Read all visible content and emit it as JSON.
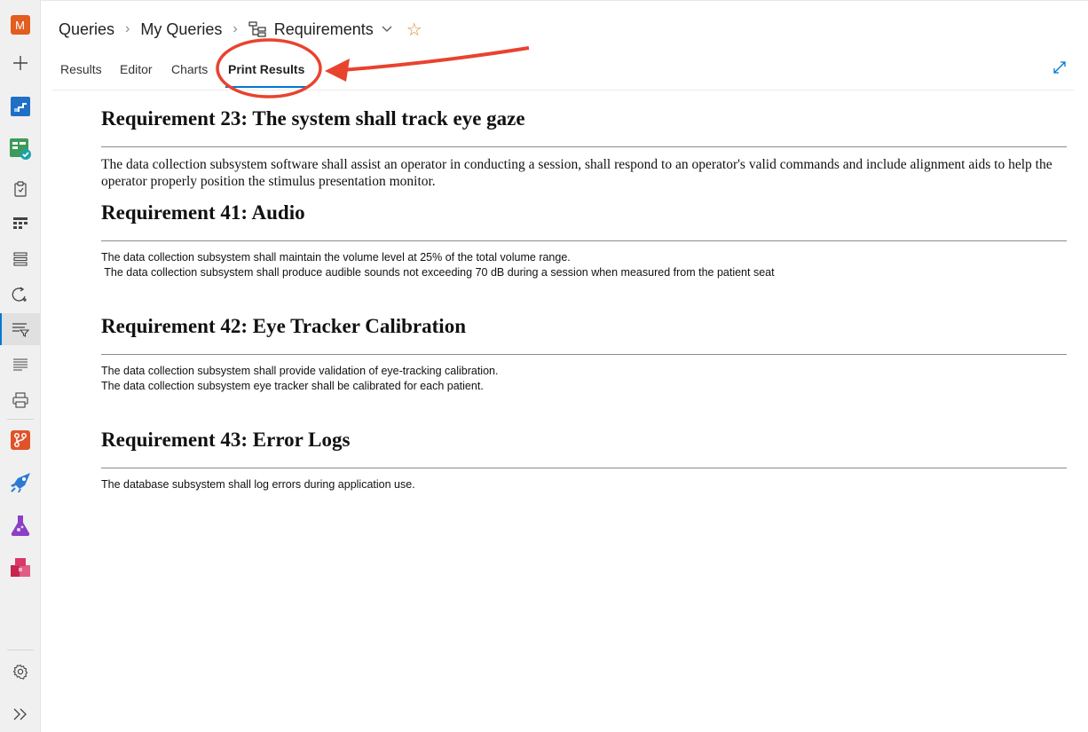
{
  "rail": {
    "avatar_letter": "M",
    "avatar_color": "#e35d1e",
    "items": [
      {
        "name": "new-item-icon"
      },
      {
        "name": "overview-icon"
      },
      {
        "name": "boards-icon"
      },
      {
        "name": "work-items-icon"
      },
      {
        "name": "boards-grid-icon"
      },
      {
        "name": "backlogs-icon"
      },
      {
        "name": "sprints-icon"
      },
      {
        "name": "queries-icon",
        "selected": true
      },
      {
        "name": "delivery-plans-icon"
      },
      {
        "name": "print-icon"
      },
      {
        "name": "repos-icon"
      },
      {
        "name": "pipelines-icon"
      },
      {
        "name": "test-plans-icon"
      },
      {
        "name": "artifacts-icon"
      },
      {
        "name": "settings-icon"
      },
      {
        "name": "collapse-icon"
      }
    ]
  },
  "breadcrumb": {
    "root": "Queries",
    "folder": "My Queries",
    "current": "Requirements"
  },
  "tabs": [
    {
      "label": "Results"
    },
    {
      "label": "Editor"
    },
    {
      "label": "Charts"
    },
    {
      "label": "Print Results",
      "active": true
    }
  ],
  "colors": {
    "accent": "#0078d4",
    "annotation": "#e8432f",
    "star": "#d8892e"
  },
  "requirements": [
    {
      "title": "Requirement 23: The system shall track eye gaze",
      "style": "serif",
      "lines": [
        "The data collection subsystem software shall assist an operator in conducting a session, shall respond to an operator's valid commands and include alignment aids to help the operator properly position the stimulus presentation monitor."
      ]
    },
    {
      "title": "Requirement 41: Audio",
      "style": "sans",
      "lines": [
        "The data collection subsystem shall maintain the volume level at 25% of the total volume range.",
        " The data collection subsystem shall produce audible sounds not exceeding 70 dB during a session when measured from the patient seat"
      ]
    },
    {
      "title": "Requirement 42: Eye Tracker Calibration",
      "style": "sans",
      "lines": [
        "The data collection subsystem shall provide validation of eye-tracking calibration.",
        "The data collection subsystem eye tracker shall be calibrated for each patient."
      ]
    },
    {
      "title": "Requirement 43: Error Logs",
      "style": "sans",
      "lines": [
        "The database subsystem shall log errors during application use."
      ]
    }
  ]
}
